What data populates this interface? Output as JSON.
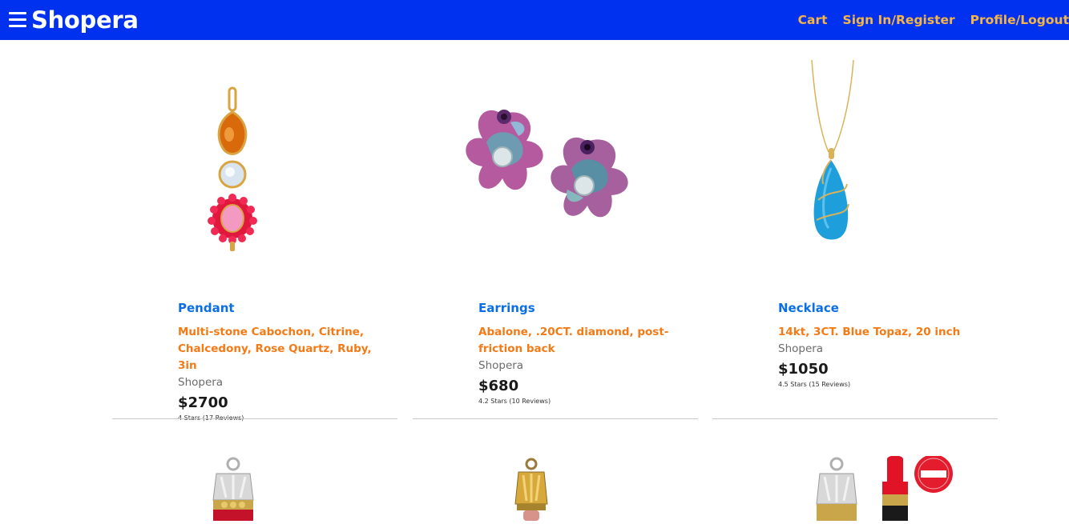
{
  "navbar": {
    "brand": "Shopera",
    "links": [
      "Cart",
      "Sign In/Register",
      "Profile/Logout"
    ],
    "bg_color": "#0031ef",
    "link_color": "#f6b545"
  },
  "products": [
    {
      "category": "Pendant",
      "description": "Multi-stone Cabochon, Citrine, Chalcedony, Rose Quartz, Ruby, 3in",
      "seller": "Shopera",
      "price": "$2700",
      "rating": "4 Stars (17 Reviews)"
    },
    {
      "category": "Earrings",
      "description": "Abalone, .20CT. diamond, post-friction back",
      "seller": "Shopera",
      "price": "$680",
      "rating": "4.2 Stars (10 Reviews)"
    },
    {
      "category": "Necklace",
      "description": "14kt, 3CT. Blue Topaz, 20 inch",
      "seller": "Shopera",
      "price": "$1050",
      "rating": "4.5 Stars (15 Reviews)"
    }
  ]
}
